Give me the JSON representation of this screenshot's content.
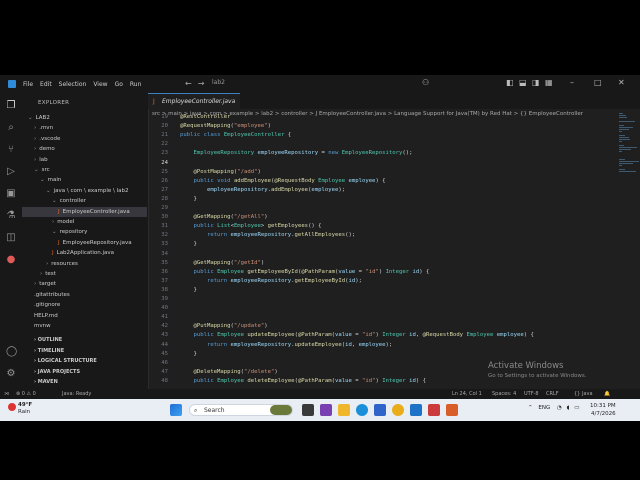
{
  "titlebar": {
    "menu": [
      "File",
      "Edit",
      "Selection",
      "View",
      "Go",
      "Run"
    ],
    "command_center": "lab2"
  },
  "sidebar": {
    "title": "EXPLORER",
    "tree": [
      {
        "label": "LAB2",
        "depth": 0,
        "chevron": "v"
      },
      {
        "label": ".mvn",
        "depth": 1,
        "chevron": ">"
      },
      {
        "label": ".vscode",
        "depth": 1,
        "chevron": ">"
      },
      {
        "label": "demo",
        "depth": 1,
        "chevron": ">"
      },
      {
        "label": "lab",
        "depth": 1,
        "chevron": ">"
      },
      {
        "label": "src",
        "depth": 1,
        "chevron": "v"
      },
      {
        "label": "main",
        "depth": 2,
        "chevron": "v"
      },
      {
        "label": "java \\ com \\ example \\ lab2",
        "depth": 3,
        "chevron": "v"
      },
      {
        "label": "controller",
        "depth": 4,
        "chevron": "v"
      },
      {
        "label": "EmployeeController.java",
        "depth": 5,
        "chevron": "",
        "java": true,
        "selected": true
      },
      {
        "label": "model",
        "depth": 4,
        "chevron": ">"
      },
      {
        "label": "repository",
        "depth": 4,
        "chevron": "v"
      },
      {
        "label": "EmployeeRepository.java",
        "depth": 5,
        "chevron": "",
        "java": true
      },
      {
        "label": "Lab2Application.java",
        "depth": 4,
        "chevron": "",
        "java": true
      },
      {
        "label": "resources",
        "depth": 3,
        "chevron": ">"
      },
      {
        "label": "test",
        "depth": 2,
        "chevron": ">"
      },
      {
        "label": "target",
        "depth": 1,
        "chevron": ">"
      },
      {
        "label": ".gitattributes",
        "depth": 1,
        "chevron": ""
      },
      {
        "label": ".gitignore",
        "depth": 1,
        "chevron": ""
      },
      {
        "label": "HELP.md",
        "depth": 1,
        "chevron": ""
      },
      {
        "label": "mvnw",
        "depth": 1,
        "chevron": ""
      }
    ],
    "sections": [
      "OUTLINE",
      "TIMELINE",
      "LOGICAL STRUCTURE",
      "JAVA PROJECTS",
      "MAVEN"
    ]
  },
  "editor": {
    "tab_label": "EmployeeController.java",
    "breadcrumb": "src > main > java > com > example > lab2 > controller > J EmployeeController.java > Language Support for Java(TM) by Red Hat > {} EmployeeController",
    "lines": [
      {
        "n": "19",
        "code": "@RestController"
      },
      {
        "n": "20",
        "code": "@RequestMapping(\"employee\")"
      },
      {
        "n": "21",
        "code": "public class EmployeeController {"
      },
      {
        "n": "22",
        "code": ""
      },
      {
        "n": "23",
        "code": "    EmployeeRepository employeeRepository = new EmployeeRepository();"
      },
      {
        "n": "24",
        "code": ""
      },
      {
        "n": "25",
        "code": "    @PostMapping(\"/add\")"
      },
      {
        "n": "26",
        "code": "    public void addEmployee(@RequestBody Employee employee) {"
      },
      {
        "n": "27",
        "code": "        employeeRepository.addEmployee(employee);"
      },
      {
        "n": "28",
        "code": "    }"
      },
      {
        "n": "29",
        "code": ""
      },
      {
        "n": "30",
        "code": "    @GetMapping(\"/getAll\")"
      },
      {
        "n": "31",
        "code": "    public List<Employee> getEmployees() {"
      },
      {
        "n": "32",
        "code": "        return employeeRepository.getAllEmployees();"
      },
      {
        "n": "33",
        "code": "    }"
      },
      {
        "n": "34",
        "code": ""
      },
      {
        "n": "35",
        "code": "    @GetMapping(\"/getId\")"
      },
      {
        "n": "36",
        "code": "    public Employee getEmployeeById(@PathParam(value = \"id\") Integer id) {"
      },
      {
        "n": "37",
        "code": "        return employeeRepository.getEmployeeById(id);"
      },
      {
        "n": "38",
        "code": "    }"
      },
      {
        "n": "39",
        "code": ""
      },
      {
        "n": "40",
        "code": ""
      },
      {
        "n": "41",
        "code": ""
      },
      {
        "n": "42",
        "code": "    @PutMapping(\"/update\")"
      },
      {
        "n": "43",
        "code": "    public Employee updateEmployee(@PathParam(value = \"id\") Integer id, @RequestBody Employee employee) {"
      },
      {
        "n": "44",
        "code": "        return employeeRepository.updateEmployee(id, employee);"
      },
      {
        "n": "45",
        "code": "    }"
      },
      {
        "n": "46",
        "code": ""
      },
      {
        "n": "47",
        "code": "    @DeleteMapping(\"/delete\")"
      },
      {
        "n": "48",
        "code": "    public Employee deleteEmployee(@PathParam(value = \"id\") Integer id) {"
      }
    ]
  },
  "statusbar": {
    "left": "Java: Ready",
    "position": "Ln 24, Col 1",
    "spaces": "Spaces: 4",
    "encoding": "UTF-8",
    "eol": "CRLF",
    "language": "{} Java"
  },
  "watermark": {
    "title": "Activate Windows",
    "subtitle": "Go to Settings to activate Windows."
  },
  "taskbar": {
    "weather_temp": "49°F",
    "weather_desc": "Rain",
    "search_placeholder": "Search",
    "language": "ENG",
    "time": "10:31 PM",
    "date": "4/7/2026"
  }
}
